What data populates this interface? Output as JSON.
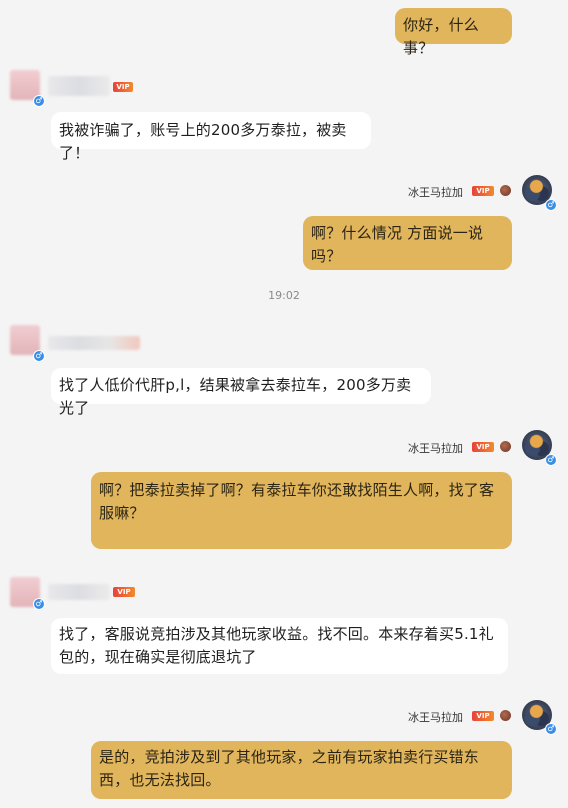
{
  "messages": [
    {
      "side": "out",
      "text": "你好，什么事？"
    },
    {
      "side": "in",
      "text": "我被诈骗了，账号上的200多万泰拉，被卖了！"
    },
    {
      "side": "out",
      "text": "啊？什么情况 方面说一说吗？"
    },
    {
      "side": "in",
      "text": "找了人低价代肝p,l，结果被拿去泰拉车，200多万卖光了"
    },
    {
      "side": "out",
      "text": "啊？把泰拉卖掉了啊？有泰拉车你还敢找陌生人啊，找了客服嘛？"
    },
    {
      "side": "in",
      "text": "找了，客服说竞拍涉及其他玩家收益。找不回。本来存着买5.1礼包的，现在确实是彻底退坑了"
    },
    {
      "side": "out",
      "text": "是的，竞拍涉及到了其他玩家，之前有玩家拍卖行买错东西，也无法找回。"
    }
  ],
  "timestamp": "19:02",
  "self_user": {
    "name": "冰王马拉加",
    "gender": "♂"
  },
  "badges": {
    "vip": "VIP",
    "gender": "♂"
  },
  "colors": {
    "out_bubble": "#e0b55b",
    "in_bubble": "#ffffff",
    "background": "#f4f4f4"
  }
}
